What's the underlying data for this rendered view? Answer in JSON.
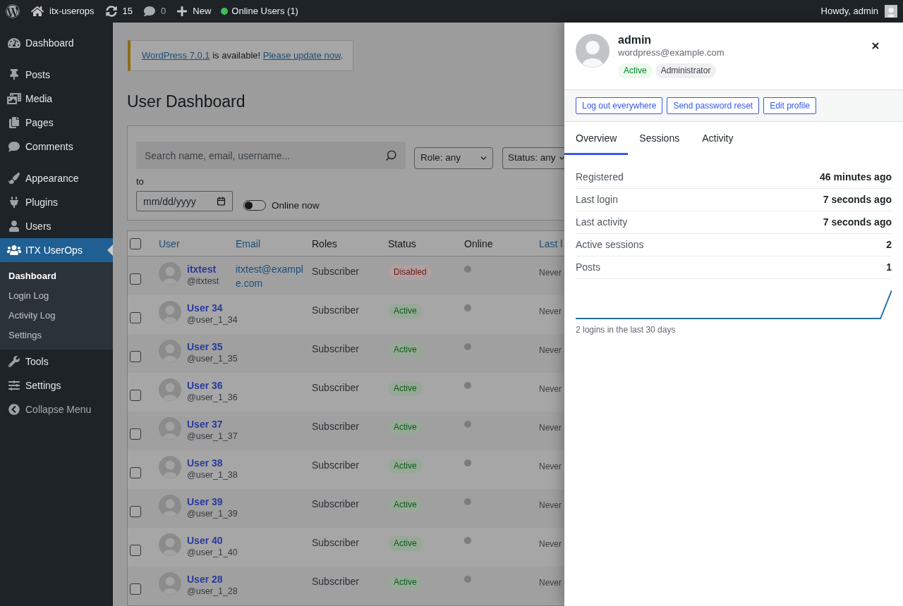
{
  "admin_bar": {
    "site_name": "itx-userops",
    "updates_count": "15",
    "comments_count": "0",
    "new_label": "New",
    "online_users": "Online Users (1)",
    "greeting": "Howdy, admin"
  },
  "sidebar": {
    "groups": [
      {
        "items": [
          {
            "label": "Dashboard",
            "selected": false
          }
        ]
      },
      {
        "items": [
          {
            "label": "Posts",
            "selected": false
          },
          {
            "label": "Media",
            "selected": false
          },
          {
            "label": "Pages",
            "selected": false
          },
          {
            "label": "Comments",
            "selected": false
          }
        ]
      },
      {
        "items": [
          {
            "label": "Appearance",
            "selected": false
          },
          {
            "label": "Plugins",
            "selected": false
          },
          {
            "label": "Users",
            "selected": false
          },
          {
            "label": "ITX UserOps",
            "selected": true,
            "children": [
              {
                "label": "Dashboard",
                "selected": true
              },
              {
                "label": "Login Log",
                "selected": false
              },
              {
                "label": "Activity Log",
                "selected": false
              },
              {
                "label": "Settings",
                "selected": false
              }
            ]
          },
          {
            "label": "Tools",
            "selected": false
          },
          {
            "label": "Settings",
            "selected": false
          }
        ]
      }
    ],
    "collapse_label": "Collapse Menu"
  },
  "notice": {
    "parts": [
      {
        "kind": "link",
        "text": "WordPress 7.0.1"
      },
      {
        "kind": "text",
        "text": " is available! "
      },
      {
        "kind": "link",
        "text": "Please update now"
      },
      {
        "kind": "text",
        "text": "."
      }
    ]
  },
  "page_title": "User Dashboard",
  "filters": {
    "search": {
      "placeholder": "Search name, email, username..."
    },
    "role": {
      "value": "Role: any"
    },
    "status": {
      "value": "Status: any"
    },
    "date_to": {
      "label": "to",
      "placeholder": "mm/dd/yyyy"
    },
    "online_toggle": {
      "label": "Online now",
      "on": false
    }
  },
  "table": {
    "select_all": {
      "checked": false
    },
    "columns": [
      {
        "label": "User",
        "sortable": true
      },
      {
        "label": "Email",
        "sortable": true
      },
      {
        "label": "Roles",
        "sortable": false
      },
      {
        "label": "Status",
        "sortable": false
      },
      {
        "label": "Online",
        "sortable": false
      },
      {
        "label": "Last l",
        "sortable": true
      }
    ],
    "rows": [
      {
        "checked": false,
        "name": "itxtest",
        "username": "@itxtest",
        "email": "itxtest@example.com",
        "role": "Subscriber",
        "status": {
          "label": "Disabled",
          "kind": "disabled"
        },
        "online": false,
        "last_login": "Never"
      },
      {
        "checked": false,
        "name": "User 34",
        "username": "@user_1_34",
        "role": "Subscriber",
        "status": {
          "label": "Active",
          "kind": "active"
        },
        "online": false,
        "last_login": "Never"
      },
      {
        "checked": false,
        "name": "User 35",
        "username": "@user_1_35",
        "role": "Subscriber",
        "status": {
          "label": "Active",
          "kind": "active"
        },
        "online": false,
        "last_login": "Never"
      },
      {
        "checked": false,
        "name": "User 36",
        "username": "@user_1_36",
        "role": "Subscriber",
        "status": {
          "label": "Active",
          "kind": "active"
        },
        "online": false,
        "last_login": "Never"
      },
      {
        "checked": false,
        "name": "User 37",
        "username": "@user_1_37",
        "role": "Subscriber",
        "status": {
          "label": "Active",
          "kind": "active"
        },
        "online": false,
        "last_login": "Never"
      },
      {
        "checked": false,
        "name": "User 38",
        "username": "@user_1_38",
        "role": "Subscriber",
        "status": {
          "label": "Active",
          "kind": "active"
        },
        "online": false,
        "last_login": "Never"
      },
      {
        "checked": false,
        "name": "User 39",
        "username": "@user_1_39",
        "role": "Subscriber",
        "status": {
          "label": "Active",
          "kind": "active"
        },
        "online": false,
        "last_login": "Never"
      },
      {
        "checked": false,
        "name": "User 40",
        "username": "@user_1_40",
        "role": "Subscriber",
        "status": {
          "label": "Active",
          "kind": "active"
        },
        "online": false,
        "last_login": "Never"
      },
      {
        "checked": false,
        "name": "User 28",
        "username": "@user_1_28",
        "role": "Subscriber",
        "status": {
          "label": "Active",
          "kind": "active"
        },
        "online": false,
        "last_login": "Never"
      }
    ]
  },
  "user_panel": {
    "name": "admin",
    "email": "wordpress@example.com",
    "badges": [
      {
        "label": "Active",
        "kind": "active"
      },
      {
        "label": "Administrator",
        "kind": "role"
      }
    ],
    "actions": [
      "Log out everywhere",
      "Send password reset",
      "Edit profile"
    ],
    "tabs": [
      {
        "label": "Overview",
        "selected": true
      },
      {
        "label": "Sessions",
        "selected": false
      },
      {
        "label": "Activity",
        "selected": false
      }
    ],
    "stats": [
      {
        "label": "Registered",
        "value": "46 minutes ago"
      },
      {
        "label": "Last login",
        "value": "7 seconds ago"
      },
      {
        "label": "Last activity",
        "value": "7 seconds ago"
      },
      {
        "label": "Active sessions",
        "value": "2"
      },
      {
        "label": "Posts",
        "value": "1"
      }
    ],
    "sparkline_caption": "2 logins in the last 30 days"
  }
}
